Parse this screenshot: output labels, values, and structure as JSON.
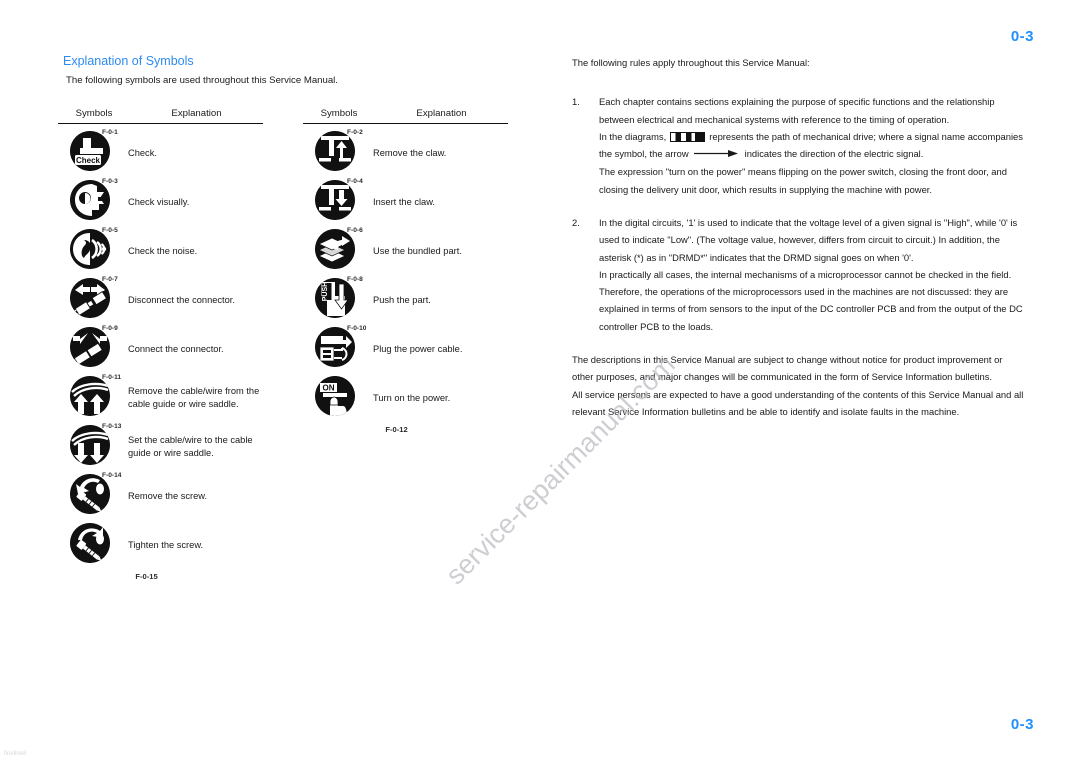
{
  "page": {
    "number_top": "0-3",
    "number_bottom": "0-3",
    "accent_color": "#1E90FF",
    "heading_color": "#2E8BEF",
    "watermark": "service-repairmanual.com",
    "footer_artifact": "fineline8"
  },
  "symbols_section": {
    "title": "Explanation of Symbols",
    "intro": "The following symbols are used throughout this Service Manual.",
    "headers": {
      "symbols": "Symbols",
      "explanation": "Explanation"
    },
    "left_table": {
      "caption": "F-0-15",
      "rows": [
        {
          "icon": "check-badge-icon",
          "figure": "F-0-1",
          "text": "Check."
        },
        {
          "icon": "eye-head-icon",
          "figure": "F-0-3",
          "text": "Check visually."
        },
        {
          "icon": "ear-sound-icon",
          "figure": "F-0-5",
          "text": "Check the noise."
        },
        {
          "icon": "connector-disconnect-icon",
          "figure": "F-0-7",
          "text": "Disconnect the connector."
        },
        {
          "icon": "connector-connect-icon",
          "figure": "F-0-9",
          "text": "Connect the connector."
        },
        {
          "icon": "cable-remove-icon",
          "figure": "F-0-11",
          "text": "Remove the cable/wire from the cable guide or wire saddle."
        },
        {
          "icon": "cable-set-icon",
          "figure": "F-0-13",
          "text": "Set the cable/wire to the cable guide or wire saddle."
        },
        {
          "icon": "screw-remove-icon",
          "figure": "F-0-14",
          "text": "Remove the screw."
        },
        {
          "icon": "screw-tighten-icon",
          "figure": "",
          "text": "Tighten the screw."
        }
      ]
    },
    "right_table": {
      "caption": "F-0-12",
      "rows": [
        {
          "icon": "claw-remove-icon",
          "figure": "F-0-2",
          "text": "Remove the claw."
        },
        {
          "icon": "claw-insert-icon",
          "figure": "F-0-4",
          "text": "Insert the claw."
        },
        {
          "icon": "bundled-part-icon",
          "figure": "F-0-6",
          "text": "Use the bundled part."
        },
        {
          "icon": "push-part-icon",
          "figure": "F-0-8",
          "text": "Push the part."
        },
        {
          "icon": "power-cable-icon",
          "figure": "F-0-10",
          "text": "Plug the power cable."
        },
        {
          "icon": "power-on-icon",
          "figure": "",
          "text": "Turn on the power."
        }
      ]
    },
    "icon_labels": {
      "check": "Check",
      "push": "PUSH",
      "on": "ON"
    }
  },
  "rules_section": {
    "lead": "The following rules apply throughout this Service Manual:",
    "items": [
      {
        "number": "1.",
        "paragraphs": [
          "Each chapter contains sections explaining the purpose of specific functions and the relationship between electrical and mechanical systems with reference to the timing of operation.",
          "The expression \"turn on the power\" means flipping on the power switch, closing the front door, and closing the delivery unit door, which results in supplying the machine with power."
        ],
        "inline_paragraph": {
          "before": "In the diagrams,",
          "middle": "represents the path of mechanical drive; where a signal name accompanies the symbol, the arrow",
          "after": "indicates the direction of the electric signal."
        }
      },
      {
        "number": "2.",
        "paragraphs": [
          "In the digital circuits, '1' is used to indicate that the voltage level of a given signal is \"High\", while '0' is used to indicate \"Low\". (The voltage value, however, differs from circuit to circuit.) In addition, the asterisk (*) as in \"DRMD*\" indicates that the DRMD signal goes on when '0'.",
          "In practically all cases, the internal mechanisms of a microprocessor cannot be checked in the field. Therefore, the operations of the microprocessors used in the machines are not discussed: they are explained in terms of from sensors to the input of the DC controller PCB and from the output of the DC controller PCB to the loads."
        ]
      }
    ],
    "closing": [
      "The descriptions in this Service Manual are subject to change without notice for product improvement or other purposes, and major changes will be communicated in the form of Service Information bulletins.",
      "All service persons are expected to have a good understanding of the contents of this Service Manual and all relevant Service Information bulletins and be able to identify and isolate faults in the machine."
    ]
  }
}
